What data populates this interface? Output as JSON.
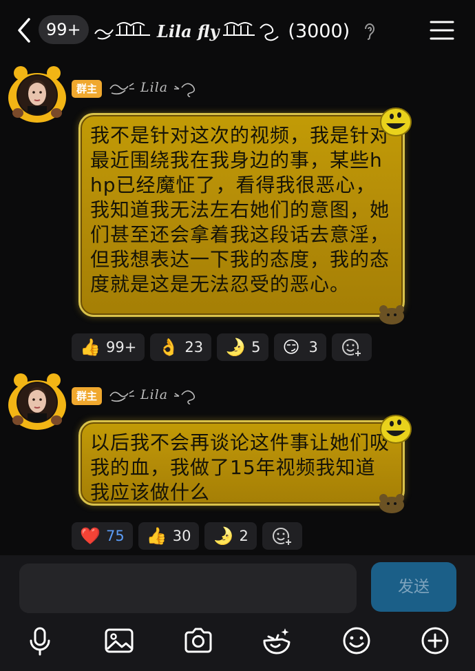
{
  "header": {
    "unread_badge": "99+",
    "group_name": "Lila fly",
    "member_count": "(3000)"
  },
  "messages": [
    {
      "role_badge": "群主",
      "sender_name": "Lila",
      "text": "我不是针对这次的视频，我是针对最近围绕我在我身边的事，某些hhp已经魔怔了，看得我很恶心，我知道我无法左右她们的意图，她们甚至还会拿着我这段话去意淫，但我想表达一下我的态度，我的态度就是这是无法忍受的恶心。",
      "reactions": [
        {
          "icon": "thumbs-up-icon",
          "count": "99+"
        },
        {
          "icon": "ok-hand-icon",
          "count": "23"
        },
        {
          "icon": "moon-face-icon",
          "count": "5"
        },
        {
          "icon": "smirk-face-icon",
          "count": "3"
        }
      ]
    },
    {
      "role_badge": "群主",
      "sender_name": "Lila",
      "text": "以后我不会再谈论这件事让她们吸我的血，我做了15年视频我知道我应该做什么",
      "reactions": [
        {
          "icon": "red-heart-icon",
          "count": "75"
        },
        {
          "icon": "thumbs-up-icon",
          "count": "30"
        },
        {
          "icon": "moon-face-icon",
          "count": "2"
        }
      ]
    }
  ],
  "composer": {
    "input_value": "",
    "send_label": "发送"
  },
  "toolbar": [
    "microphone-icon",
    "image-icon",
    "camera-icon",
    "sticker-icon",
    "emoji-icon",
    "plus-icon"
  ],
  "colors": {
    "background": "#0b0b0c",
    "bubble_gold": "#b58d08",
    "badge_orange": "#f0a82e",
    "send_blue": "#1b5f88",
    "link_blue": "#5b9cf5"
  }
}
